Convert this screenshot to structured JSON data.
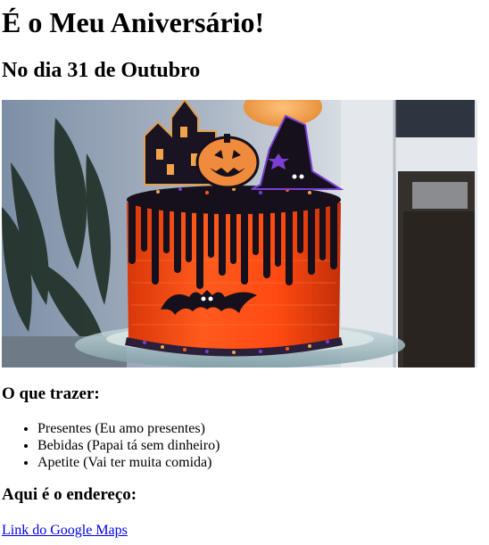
{
  "page": {
    "title": "É o Meu Aniversário!",
    "date_heading": "No dia 31 de Outubro",
    "bring_heading": "O que trazer:",
    "bring_items": [
      "Presentes (Eu amo presentes)",
      "Bebidas (Papai tá sem dinheiro)",
      "Apetite (Vai ter muita comida)"
    ],
    "address_heading": "Aqui é o endereço:",
    "maps_link_label": "Link do Google Maps"
  },
  "colors": {
    "link": "#0000ee",
    "cake_orange": "#ff4a12",
    "icing_black": "#15101c",
    "glitter_purple": "#7a3fd0",
    "glitter_gold": "#f2a24a"
  },
  "image": {
    "subject": "halloween-cake-photo"
  }
}
